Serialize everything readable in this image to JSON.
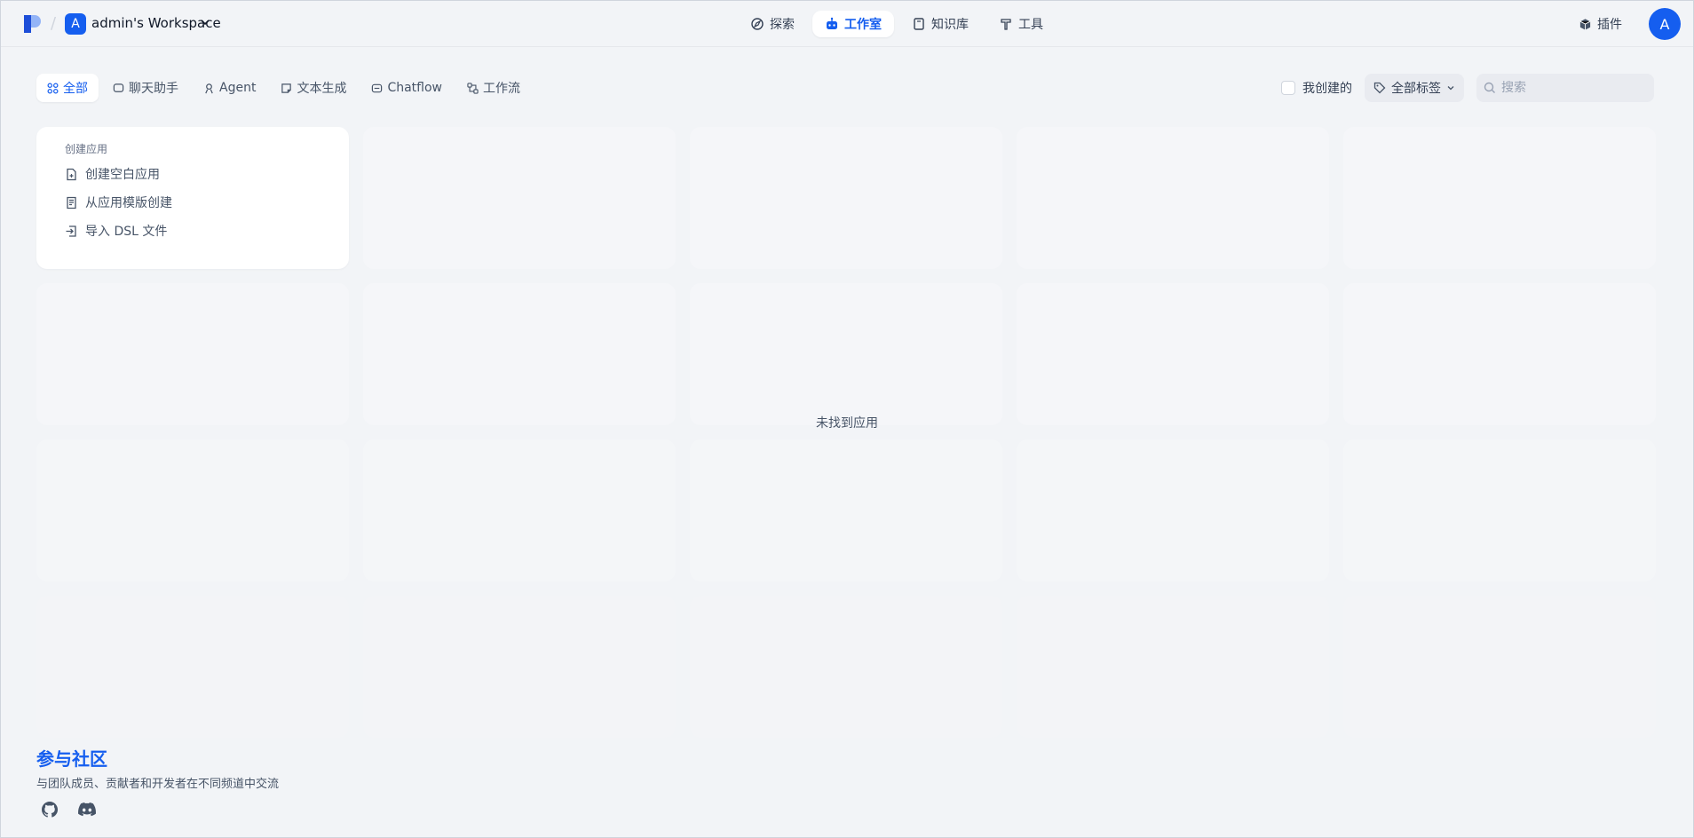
{
  "header": {
    "workspace_initial": "A",
    "workspace_name": "admin's Workspace",
    "nav": [
      {
        "label": "探索",
        "icon": "compass-icon"
      },
      {
        "label": "工作室",
        "icon": "robot-icon"
      },
      {
        "label": "知识库",
        "icon": "book-icon"
      },
      {
        "label": "工具",
        "icon": "hammer-icon"
      }
    ],
    "plugin_label": "插件",
    "user_initial": "A"
  },
  "filters": {
    "tabs": [
      {
        "label": "全部"
      },
      {
        "label": "聊天助手"
      },
      {
        "label": "Agent"
      },
      {
        "label": "文本生成"
      },
      {
        "label": "Chatflow"
      },
      {
        "label": "工作流"
      }
    ],
    "mine_label": "我创建的",
    "tags_label": "全部标签",
    "search_placeholder": "搜索"
  },
  "create": {
    "title": "创建应用",
    "items": [
      {
        "label": "创建空白应用",
        "icon": "file-plus-icon"
      },
      {
        "label": "从应用模版创建",
        "icon": "template-icon"
      },
      {
        "label": "导入 DSL 文件",
        "icon": "import-icon"
      }
    ]
  },
  "empty_text": "未找到应用",
  "footer": {
    "title": "参与社区",
    "desc": "与团队成员、贡献者和开发者在不同频道中交流",
    "social": [
      "github-icon",
      "discord-icon"
    ]
  },
  "colors": {
    "accent": "#155eef",
    "background": "#f2f4f7"
  }
}
